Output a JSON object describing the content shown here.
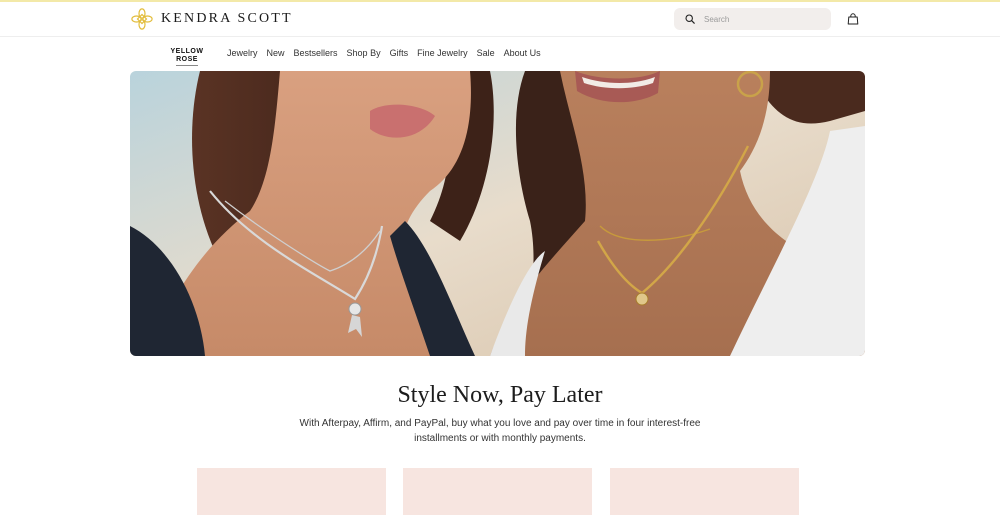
{
  "brand": {
    "name": "KENDRA SCOTT",
    "accent_color": "#e8c54a"
  },
  "search": {
    "placeholder": "Search",
    "icon": "search-icon"
  },
  "header": {
    "bag_icon": "shopping-bag-icon"
  },
  "nav": {
    "sub_brand": "YELLOW ROSE",
    "items": [
      {
        "label": "Jewelry"
      },
      {
        "label": "New"
      },
      {
        "label": "Bestsellers"
      },
      {
        "label": "Shop By"
      },
      {
        "label": "Gifts"
      },
      {
        "label": "Fine Jewelry"
      },
      {
        "label": "Sale"
      },
      {
        "label": "About Us"
      }
    ]
  },
  "promo": {
    "headline": "Style Now, Pay Later",
    "body": "With Afterpay, Affirm, and PayPal, buy what you love and pay over time in four interest-free installments or with monthly payments."
  },
  "colors": {
    "card_background": "#f7e5e0",
    "search_background": "#f2eeec"
  }
}
